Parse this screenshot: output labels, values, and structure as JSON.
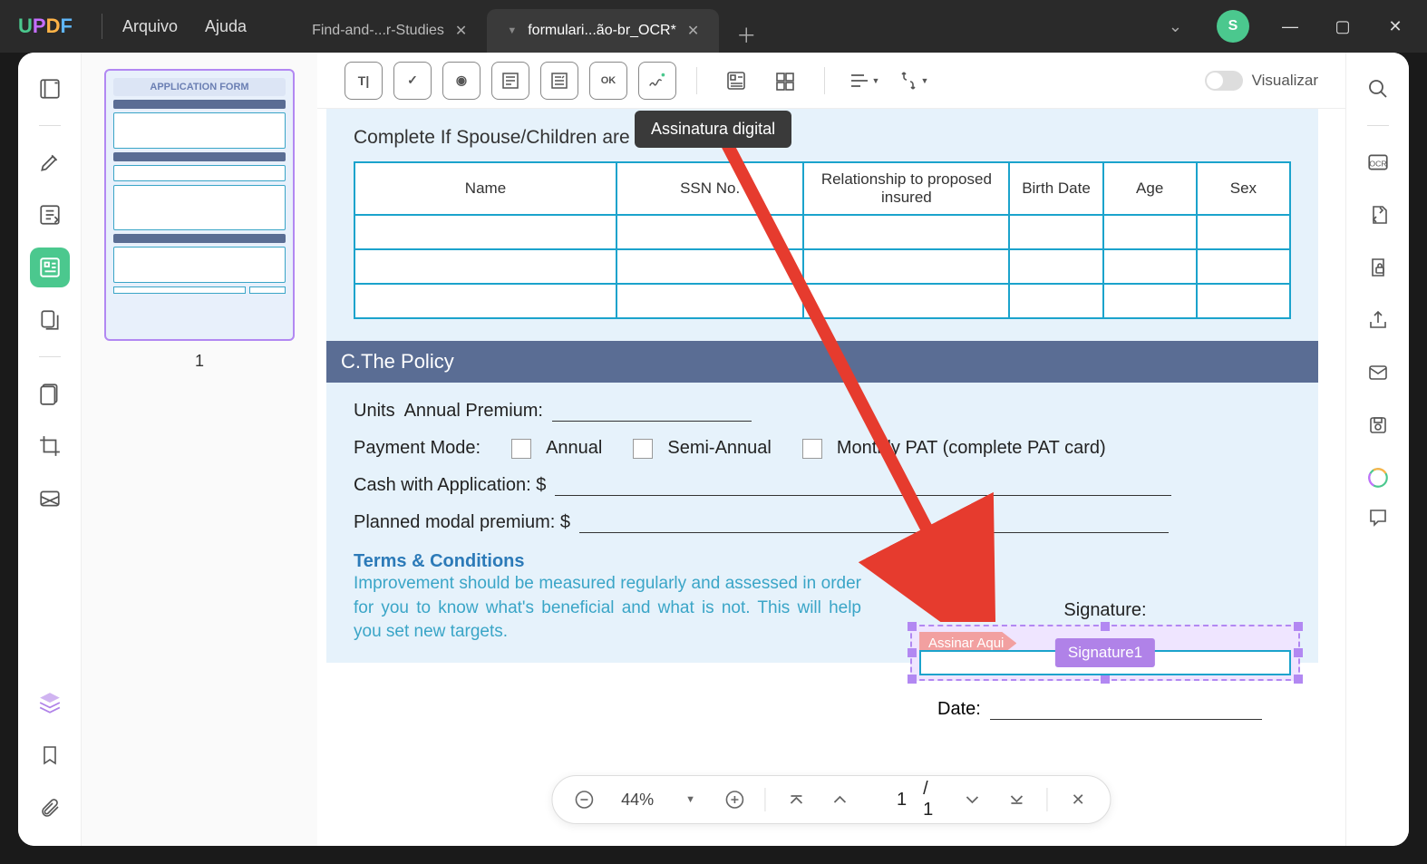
{
  "logo": [
    "U",
    "P",
    "D",
    "F"
  ],
  "menu": {
    "file": "Arquivo",
    "help": "Ajuda"
  },
  "tabs": [
    {
      "title": "Find-and-...r-Studies",
      "active": false
    },
    {
      "title": "formulari...ão-br_OCR*",
      "active": true
    }
  ],
  "avatar": "S",
  "tooltip": "Assinatura digital",
  "preview_label": "Visualizar",
  "thumb": {
    "title": "APPLICATION FORM",
    "page": "1"
  },
  "doc": {
    "section_title": "Complete If Spouse/Children are Proposed",
    "headers": [
      "Name",
      "SSN No.",
      "Relationship to proposed insured",
      "Birth Date",
      "Age",
      "Sex"
    ],
    "policy_header": "C.The Policy",
    "units": "Units",
    "premium": "Annual Premium:",
    "payment_mode": "Payment Mode:",
    "annual": "Annual",
    "semi": "Semi-Annual",
    "monthly": "Monthly PAT (complete PAT card)",
    "cash": "Cash with Application: $",
    "planned": "Planned modal premium: $",
    "terms_title": "Terms & Conditions",
    "terms_text": "Improvement should be measured regularly and assessed in order for you to know what's beneficial and what is not. This will help you set new targets.",
    "signature": "Signature:",
    "sign_here": "Assinar Aqui",
    "sig_field": "Signature1",
    "date": "Date:"
  },
  "bottombar": {
    "zoom": "44%",
    "page": "1",
    "total": "/ 1"
  }
}
